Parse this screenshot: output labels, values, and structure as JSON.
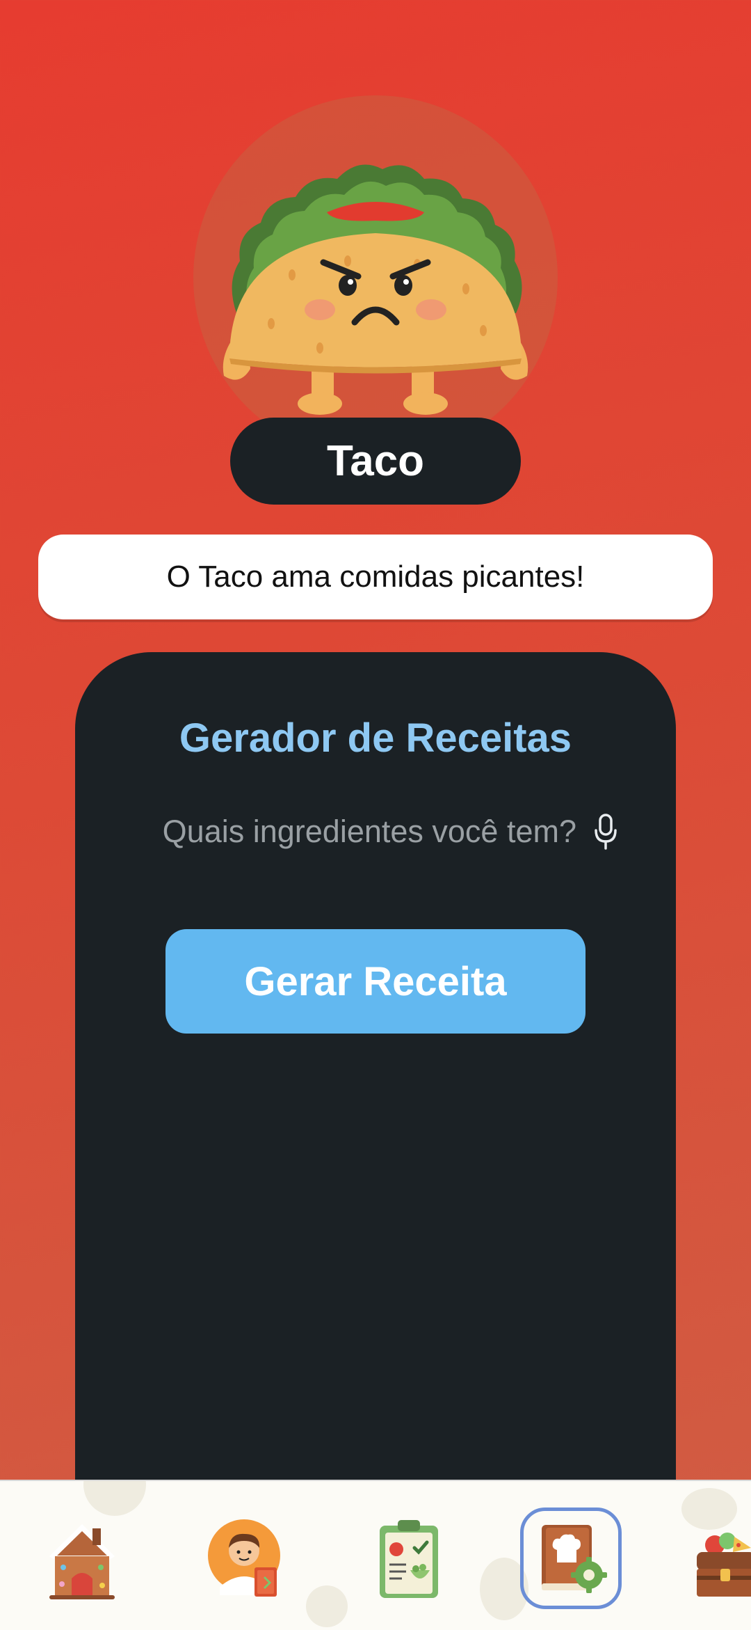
{
  "character": {
    "name": "Taco",
    "tagline": "O Taco ama comidas picantes!"
  },
  "recipe_generator": {
    "title": "Gerador de Receitas",
    "ingredients_placeholder": "Quais ingredientes você tem?",
    "generate_label": "Gerar Receita"
  },
  "bottom_nav": {
    "items": [
      {
        "icon": "gingerbread-house-icon"
      },
      {
        "icon": "chef-avatar-icon"
      },
      {
        "icon": "meal-plan-clipboard-icon"
      },
      {
        "icon": "recipe-book-settings-icon",
        "active": true
      },
      {
        "icon": "treasure-chest-icon"
      }
    ]
  },
  "colors": {
    "background_top": "#e63c30",
    "background_bottom": "#cf5e44",
    "panel": "#1b2125",
    "title_accent": "#8ec8f2",
    "button": "#62b8f0",
    "active_nav_border": "#6b8ed6"
  }
}
